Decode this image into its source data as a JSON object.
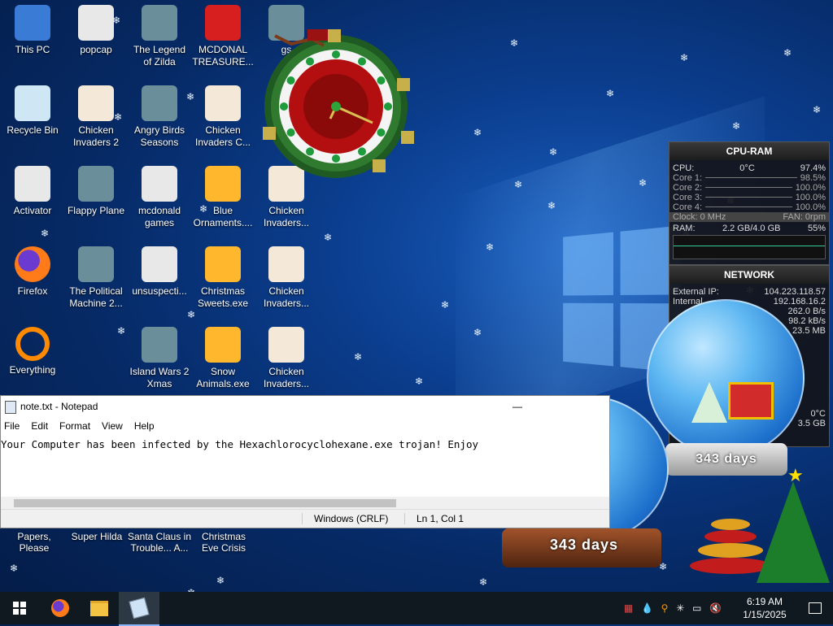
{
  "desktop": {
    "icons": [
      {
        "label": "This PC",
        "icon": "computer-icon"
      },
      {
        "label": "Recycle Bin",
        "icon": "recycle-bin-icon"
      },
      {
        "label": "Activator",
        "icon": "folder-icon"
      },
      {
        "label": "Firefox",
        "icon": "firefox-icon"
      },
      {
        "label": "Everything",
        "icon": "search-icon"
      },
      {
        "label": "popcap",
        "icon": "folder-icon"
      },
      {
        "label": "Chicken Invaders 2",
        "icon": "chicken-icon"
      },
      {
        "label": "Flappy Plane",
        "icon": "game-icon"
      },
      {
        "label": "The Political Machine 2...",
        "icon": "game-icon"
      },
      {
        "label": "The Legend of Zilda",
        "icon": "game-icon"
      },
      {
        "label": "Angry Birds Seasons",
        "icon": "game-icon"
      },
      {
        "label": "mcdonald games",
        "icon": "folder-icon"
      },
      {
        "label": "unsuspecti...",
        "icon": "folder-icon"
      },
      {
        "label": "Island Wars 2 Xmas",
        "icon": "game-icon"
      },
      {
        "label": "MCDONAL TREASURE...",
        "icon": "mcdonalds-icon"
      },
      {
        "label": "Chicken Invaders C...",
        "icon": "chicken-icon"
      },
      {
        "label": "Blue Ornaments....",
        "icon": "exe-icon"
      },
      {
        "label": "Christmas Sweets.exe",
        "icon": "exe-icon"
      },
      {
        "label": "Snow Animals.exe",
        "icon": "exe-icon"
      },
      {
        "label": "gs",
        "icon": "game-icon"
      },
      {
        "label": "Chicken Invaders...",
        "icon": "chicken-icon"
      },
      {
        "label": "Chicken Invaders...",
        "icon": "chicken-icon"
      },
      {
        "label": "Chicken Invaders...",
        "icon": "chicken-icon"
      }
    ],
    "bottom_labels": [
      "Papers, Please",
      "Super Hilda",
      "Santa Claus in Trouble... A...",
      "Christmas Eve Crisis"
    ]
  },
  "cpu_gadget": {
    "title": "CPU-RAM",
    "cpu_label": "CPU:",
    "cpu_temp": "0°C",
    "cpu_pct": "97.4%",
    "cores": [
      {
        "label": "Core 1:",
        "value": "98.5%"
      },
      {
        "label": "Core 2:",
        "value": "100.0%"
      },
      {
        "label": "Core 3:",
        "value": "100.0%"
      },
      {
        "label": "Core 4:",
        "value": "100.0%"
      }
    ],
    "clock": "Clock: 0 MHz",
    "fan": "FAN: 0rpm",
    "ram_label": "RAM:",
    "ram_value": "2.2 GB/4.0 GB",
    "ram_pct": "55%"
  },
  "network_gadget": {
    "title": "NETWORK",
    "rows": [
      {
        "label": "External IP:",
        "value": "104.223.118.57"
      },
      {
        "label": "Internal",
        "value": "192.168.16.2"
      },
      {
        "label": "",
        "value": "262.0 B/s"
      },
      {
        "label": "",
        "value": "98.2 kB/s"
      },
      {
        "label": "",
        "value": "23.5 MB"
      }
    ],
    "temp": "0°C",
    "size": "3.5 GB"
  },
  "notepad": {
    "title": "note.txt - Notepad",
    "menu": [
      "File",
      "Edit",
      "Format",
      "View",
      "Help"
    ],
    "text": "Your Computer has been infected by the Hexachlorocyclohexane.exe trojan! Enjoy",
    "encoding": "Windows (CRLF)",
    "position": "Ln 1, Col 1"
  },
  "snowglobes": {
    "left_days": "343 days",
    "right_days": "343 days"
  },
  "taskbar": {
    "time": "6:19 AM",
    "date": "1/15/2025"
  }
}
